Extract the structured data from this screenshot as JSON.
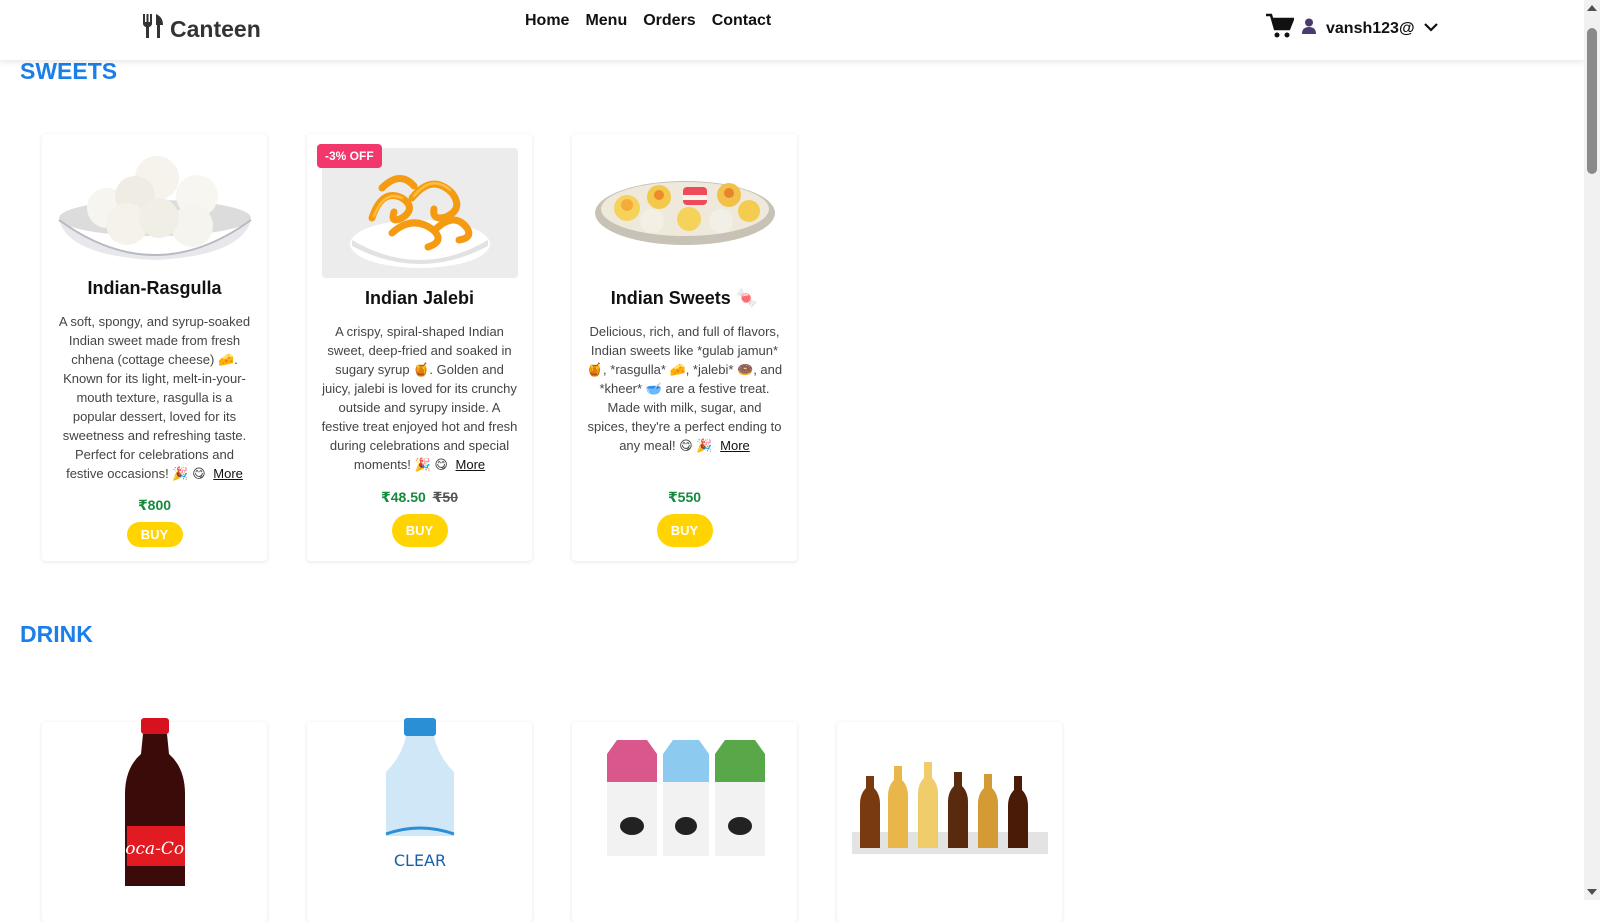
{
  "nav": {
    "brand": "Canteen",
    "links": [
      "Home",
      "Menu",
      "Orders",
      "Contact"
    ],
    "username": "vansh123@"
  },
  "sections": {
    "sweets": {
      "title": "SWEETS",
      "items": [
        {
          "name": "Indian-Rasgulla",
          "description": "A soft, spongy, and syrup-soaked Indian sweet made from fresh chhena (cottage cheese) 🧀. Known for its light, melt-in-your-mouth texture, rasgulla is a popular dessert, loved for its sweetness and refreshing taste. Perfect for celebrations and festive occasions! 🎉 😋",
          "more": "More",
          "price": "₹800",
          "old_price": "",
          "badge": "",
          "buy": "BUY"
        },
        {
          "name": "Indian Jalebi",
          "description": "A crispy, spiral-shaped Indian sweet, deep-fried and soaked in sugary syrup 🍯. Golden and juicy, jalebi is loved for its crunchy outside and syrupy inside. A festive treat enjoyed hot and fresh during celebrations and special moments! 🎉 😋",
          "more": "More",
          "price": "₹48.50",
          "old_price": "₹50",
          "badge": "-3% OFF",
          "buy": "BUY"
        },
        {
          "name": "Indian Sweets 🍬",
          "description": "Delicious, rich, and full of flavors, Indian sweets like *gulab jamun* 🍯, *rasgulla* 🧀, *jalebi* 🍩, and *kheer* 🥣 are a festive treat. Made with milk, sugar, and spices, they're a perfect ending to any meal! 😋 🎉",
          "more": "More",
          "price": "₹550",
          "old_price": "",
          "badge": "",
          "buy": "BUY"
        }
      ]
    },
    "drink": {
      "title": "DRINK"
    }
  },
  "colors": {
    "section_title": "#1a7fe8",
    "price": "#168a3c",
    "buy_button": "#ffd400",
    "badge": "#f2376d"
  }
}
